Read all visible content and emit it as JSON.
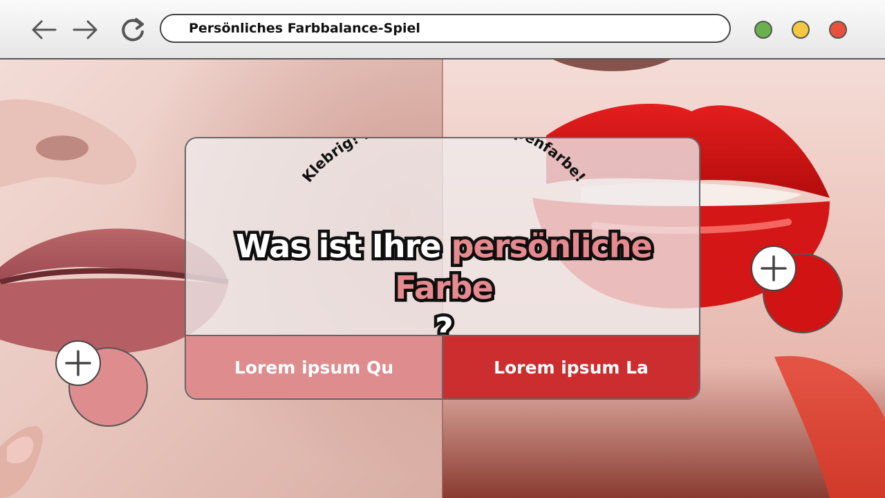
{
  "browser": {
    "url_text": "Persönliches Farbbalance-Spiel",
    "window_dots": [
      "#6ab04c",
      "#f5c842",
      "#e8513c"
    ]
  },
  "quiz": {
    "arc_text": "Klebrig! Finden Sie Ihre Lippenfarbe!",
    "question_before": "Was ist Ihre ",
    "question_highlight": "persönliche Farbe",
    "question_after": "?",
    "options": [
      {
        "label": "Lorem ipsum Qu",
        "color": "#de8c8e"
      },
      {
        "label": "Lorem ipsum La",
        "color": "#cc2e2f"
      }
    ]
  },
  "swatches": {
    "left_color": "#de8c8e",
    "right_color": "#d21313"
  }
}
